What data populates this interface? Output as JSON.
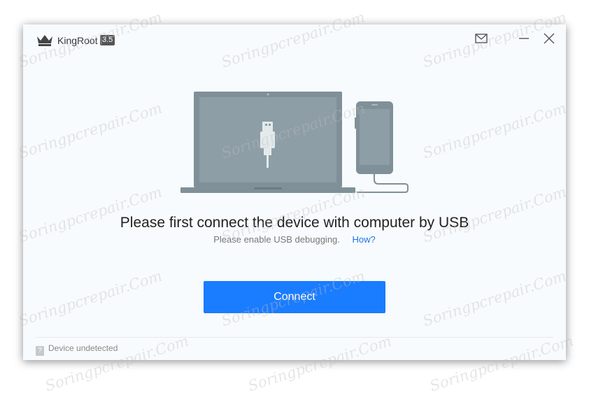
{
  "window": {
    "app_name": "KingRoot",
    "version": "3.5",
    "icons": [
      "crown-logo-icon",
      "mail-icon",
      "minimize-icon",
      "close-icon"
    ]
  },
  "main": {
    "headline": "Please first connect the device with computer by USB",
    "subtext": "Please enable USB debugging.",
    "help_link": "How?",
    "connect_label": "Connect"
  },
  "status": {
    "text": "Device undetected"
  },
  "watermark": "Soringpcrepair.Com",
  "colors": {
    "accent": "#1a7cff",
    "link": "#1a73e8",
    "illustration": "#7f9098",
    "screen": "#8d9ea6"
  }
}
